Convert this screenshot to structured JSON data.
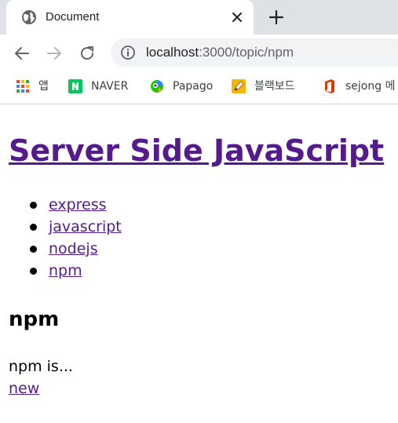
{
  "browser": {
    "tab": {
      "title": "Document",
      "favicon": "globe-icon",
      "close_icon": "close-icon"
    },
    "new_tab_icon": "plus-icon",
    "toolbar": {
      "back_icon": "back-arrow-icon",
      "forward_icon": "forward-arrow-icon",
      "reload_icon": "reload-icon",
      "site_info_icon": "info-icon",
      "url_host": "localhost",
      "url_path": ":3000/topic/npm"
    },
    "bookmarks": [
      {
        "label": "앱",
        "icon": "apps-grid-icon"
      },
      {
        "label": "NAVER",
        "icon": "naver-icon"
      },
      {
        "label": "Papago",
        "icon": "papago-icon"
      },
      {
        "label": "블랙보드",
        "icon": "pencil-icon"
      },
      {
        "label": "sejong 메",
        "icon": "office-icon"
      }
    ]
  },
  "page": {
    "title": "Server Side JavaScript",
    "topics": [
      "express",
      "javascript",
      "nodejs",
      "npm"
    ],
    "topic_heading": "npm",
    "description": "npm is...",
    "new_link": "new"
  },
  "colors": {
    "tabstrip_bg": "#dee1e6",
    "omnibox_bg": "#f1f3f4",
    "link_visited": "#551a8b",
    "naver_green": "#03c75a",
    "office_red": "#d83b01"
  }
}
